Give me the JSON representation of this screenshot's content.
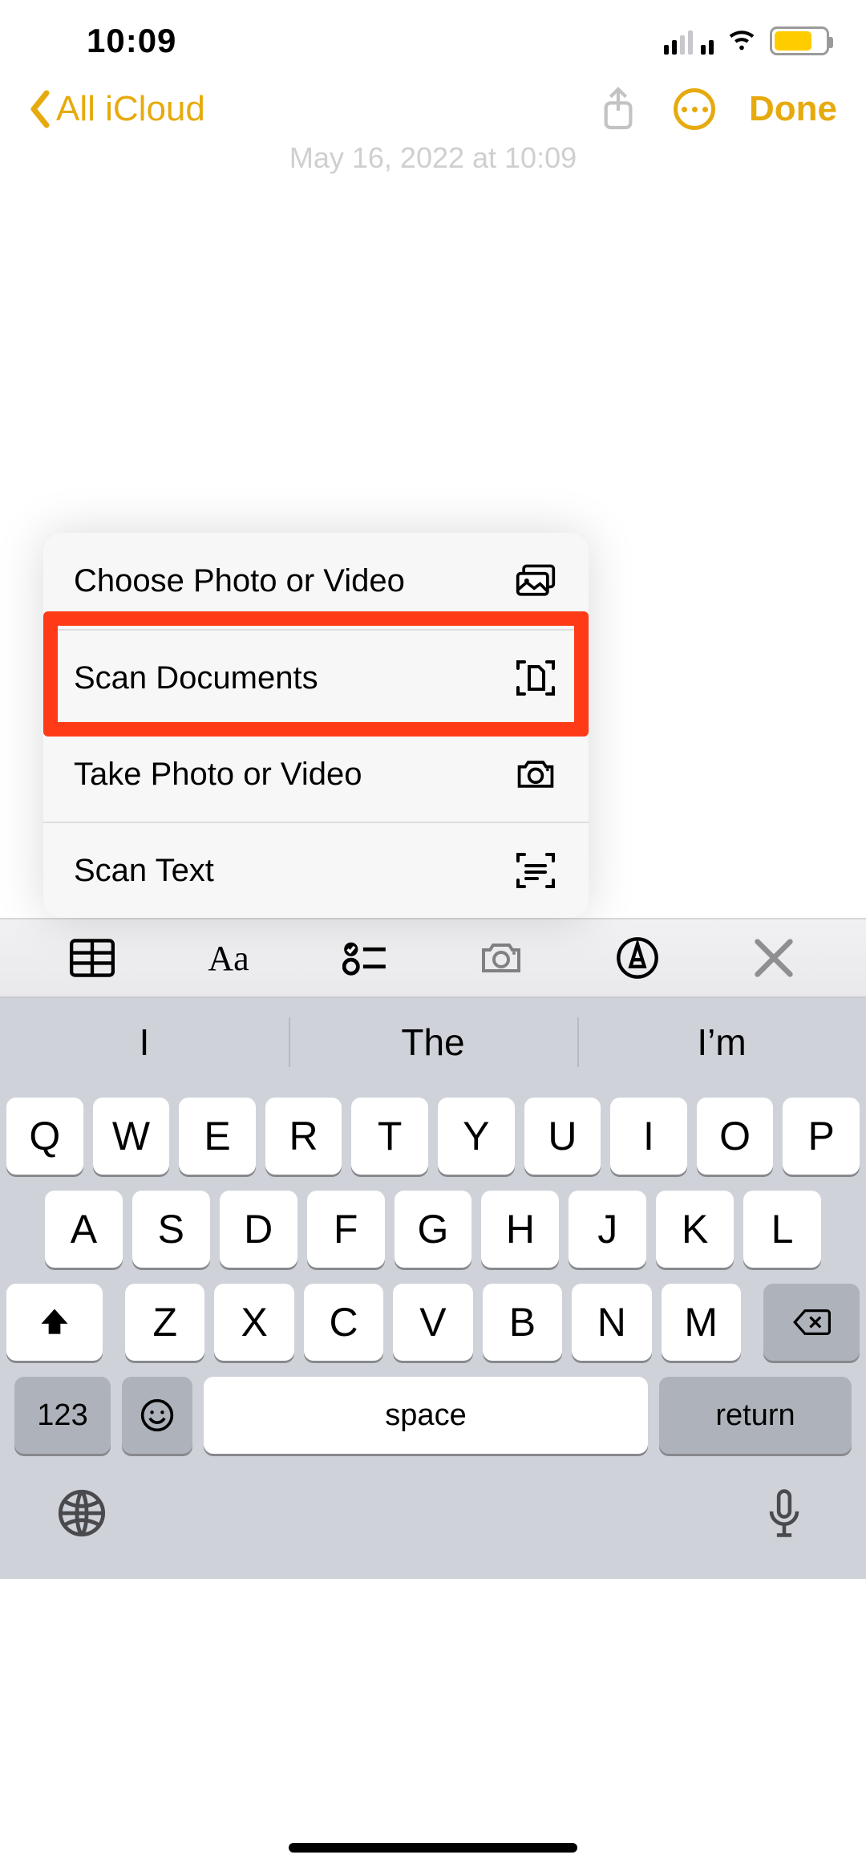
{
  "status": {
    "time": "10:09"
  },
  "nav": {
    "back_label": "All iCloud",
    "done_label": "Done",
    "date_stamp": "May 16, 2022 at 10:09"
  },
  "menu": {
    "items": [
      {
        "label": "Choose Photo or Video",
        "icon": "photos-icon"
      },
      {
        "label": "Scan Documents",
        "icon": "scan-doc-icon",
        "highlighted": true
      },
      {
        "label": "Take Photo or Video",
        "icon": "camera-icon"
      },
      {
        "label": "Scan Text",
        "icon": "scan-text-icon"
      }
    ]
  },
  "format_bar": {
    "aa_label": "Aa"
  },
  "suggestions": [
    "I",
    "The",
    "I’m"
  ],
  "keyboard": {
    "rows": [
      [
        "Q",
        "W",
        "E",
        "R",
        "T",
        "Y",
        "U",
        "I",
        "O",
        "P"
      ],
      [
        "A",
        "S",
        "D",
        "F",
        "G",
        "H",
        "J",
        "K",
        "L"
      ],
      [
        "Z",
        "X",
        "C",
        "V",
        "B",
        "N",
        "M"
      ]
    ],
    "k123": "123",
    "space": "space",
    "return": "return"
  }
}
